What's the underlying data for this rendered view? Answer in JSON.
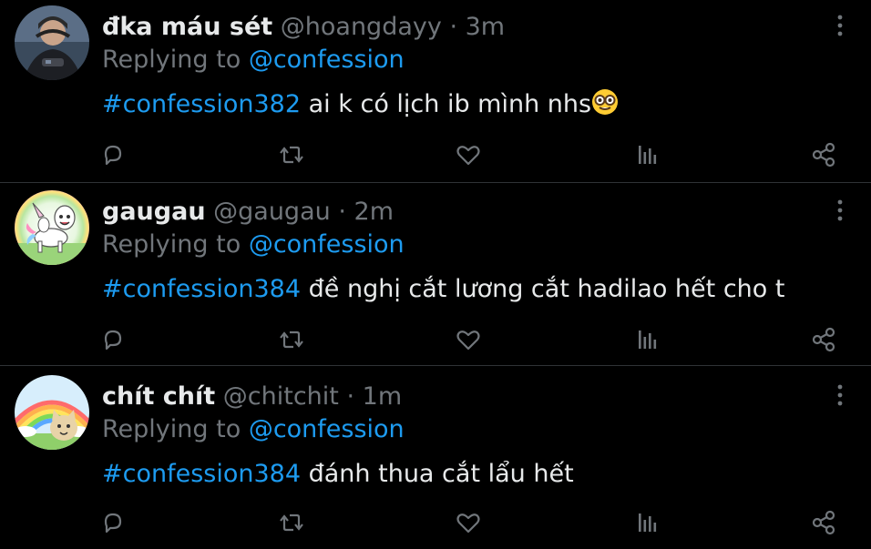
{
  "tweets": [
    {
      "display_name": "đka máu sét",
      "handle": "@hoangdayy",
      "separator": "·",
      "time": "3m",
      "replying_prefix": "Replying to",
      "replying_to": "@confession",
      "hashtag": "#confession382",
      "text": "ai k có lịch ib mình nhs",
      "emoji": "nerd-face-emoji",
      "avatar": "gamer-avatar"
    },
    {
      "display_name": "gaugau",
      "handle": "@gaugau",
      "separator": "·",
      "time": "2m",
      "replying_prefix": "Replying to",
      "replying_to": "@confession",
      "hashtag": "#confession384",
      "text": "đề nghị cắt lương cắt hadilao hết cho t",
      "avatar": "unicorn-avatar"
    },
    {
      "display_name": "chít chít",
      "handle": "@chitchit",
      "separator": "·",
      "time": "1m",
      "replying_prefix": "Replying to",
      "replying_to": "@confession",
      "hashtag": "#confession384",
      "text": "đánh thua cắt lẩu hết",
      "avatar": "rainbow-cat-avatar"
    }
  ],
  "icons": {
    "reply": "reply-icon",
    "retweet": "retweet-icon",
    "like": "like-icon",
    "views": "views-icon",
    "share": "share-icon",
    "more": "more-icon"
  },
  "colors": {
    "background": "#000000",
    "text": "#e7e9ea",
    "muted": "#71767b",
    "accent": "#1d9bf0",
    "divider": "#2f3336"
  }
}
